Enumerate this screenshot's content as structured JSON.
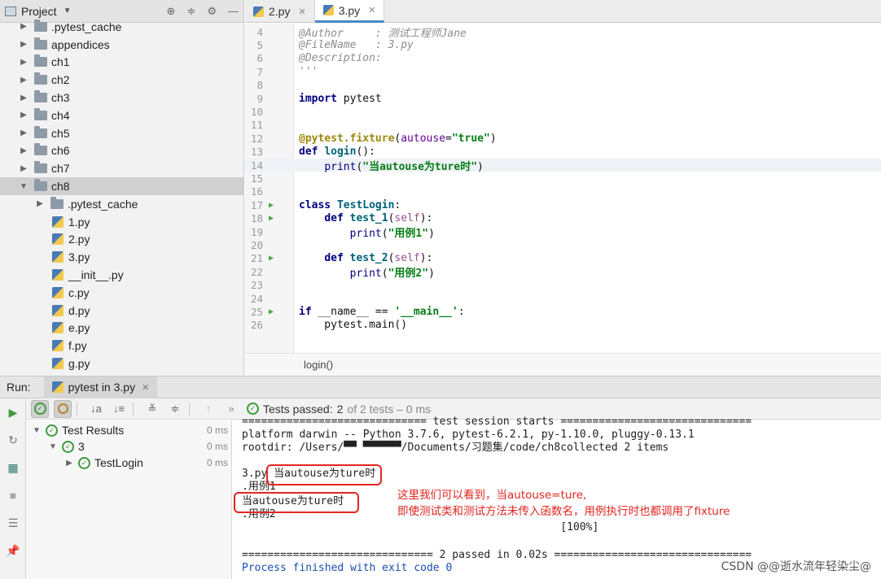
{
  "project": {
    "title": "Project",
    "tree": [
      {
        "label": ".pytest_cache",
        "kind": "folder",
        "depth": 0,
        "expanded": false
      },
      {
        "label": "appendices",
        "kind": "folder",
        "depth": 0,
        "expanded": false
      },
      {
        "label": "ch1",
        "kind": "folder",
        "depth": 0,
        "expanded": false
      },
      {
        "label": "ch2",
        "kind": "folder",
        "depth": 0,
        "expanded": false
      },
      {
        "label": "ch3",
        "kind": "folder",
        "depth": 0,
        "expanded": false
      },
      {
        "label": "ch4",
        "kind": "folder",
        "depth": 0,
        "expanded": false
      },
      {
        "label": "ch5",
        "kind": "folder",
        "depth": 0,
        "expanded": false
      },
      {
        "label": "ch6",
        "kind": "folder",
        "depth": 0,
        "expanded": false
      },
      {
        "label": "ch7",
        "kind": "folder",
        "depth": 0,
        "expanded": false
      },
      {
        "label": "ch8",
        "kind": "folder",
        "depth": 0,
        "expanded": true,
        "selected": true
      },
      {
        "label": ".pytest_cache",
        "kind": "folder",
        "depth": 1,
        "expanded": false
      },
      {
        "label": "1.py",
        "kind": "file",
        "depth": 1
      },
      {
        "label": "2.py",
        "kind": "file",
        "depth": 1
      },
      {
        "label": "3.py",
        "kind": "file",
        "depth": 1
      },
      {
        "label": "__init__.py",
        "kind": "file",
        "depth": 1
      },
      {
        "label": "c.py",
        "kind": "file",
        "depth": 1
      },
      {
        "label": "d.py",
        "kind": "file",
        "depth": 1
      },
      {
        "label": "e.py",
        "kind": "file",
        "depth": 1
      },
      {
        "label": "f.py",
        "kind": "file",
        "depth": 1
      },
      {
        "label": "g.py",
        "kind": "file",
        "depth": 1
      }
    ]
  },
  "editor": {
    "tabs": [
      {
        "label": "2.py",
        "active": false
      },
      {
        "label": "3.py",
        "active": true
      }
    ],
    "lines": [
      {
        "n": "4",
        "html": "<span class=\"cm\">@Author     : 测试工程师Jane</span>"
      },
      {
        "n": "5",
        "html": "<span class=\"cm\">@FileName   : 3.py</span>"
      },
      {
        "n": "6",
        "html": "<span class=\"cm\">@Description:</span>"
      },
      {
        "n": "7",
        "html": "<span class=\"cm\">'''</span>"
      },
      {
        "n": "8",
        "html": ""
      },
      {
        "n": "9",
        "html": "<span class=\"k\">import</span> pytest"
      },
      {
        "n": "10",
        "html": ""
      },
      {
        "n": "11",
        "html": ""
      },
      {
        "n": "12",
        "html": "<span class=\"dec\">@pytest.fixture</span>(<span class=\"kw\">autouse</span>=<span class=\"st\">\"true\"</span>)"
      },
      {
        "n": "13",
        "html": "<span class=\"k\">def</span> <span class=\"fn\">login</span>():"
      },
      {
        "n": "14",
        "html": "    <span class=\"bi\">print</span>(<span class=\"st\">\"当autouse为ture时\"</span>)",
        "current": true
      },
      {
        "n": "15",
        "html": ""
      },
      {
        "n": "16",
        "html": ""
      },
      {
        "n": "17",
        "html": "<span class=\"k\">class</span> <span class=\"fn\">TestLogin</span>:",
        "run": true
      },
      {
        "n": "18",
        "html": "    <span class=\"k\">def</span> <span class=\"fn\">test_1</span>(<span class=\"self\">self</span>):",
        "run": true
      },
      {
        "n": "19",
        "html": "        <span class=\"bi\">print</span>(<span class=\"st\">\"用例1\"</span>)"
      },
      {
        "n": "20",
        "html": ""
      },
      {
        "n": "21",
        "html": "    <span class=\"k\">def</span> <span class=\"fn\">test_2</span>(<span class=\"self\">self</span>):",
        "run": true
      },
      {
        "n": "22",
        "html": "        <span class=\"bi\">print</span>(<span class=\"st\">\"用例2\"</span>)"
      },
      {
        "n": "23",
        "html": ""
      },
      {
        "n": "24",
        "html": ""
      },
      {
        "n": "25",
        "html": "<span class=\"k\">if</span> __name__ == <span class=\"st\">'__main__'</span>:",
        "run": true
      },
      {
        "n": "26",
        "html": "    pytest.main()"
      }
    ],
    "breadcrumb": "login()"
  },
  "run": {
    "label": "Run:",
    "tab_label": "pytest in 3.py",
    "summary": {
      "prefix": "Tests passed:",
      "passed": "2",
      "rest": "of 2 tests – 0 ms"
    },
    "results": [
      {
        "name": "Test Results",
        "time": "0 ms",
        "depth": 0
      },
      {
        "name": "3",
        "time": "0 ms",
        "depth": 1
      },
      {
        "name": "TestLogin",
        "time": "0 ms",
        "depth": 2
      }
    ],
    "console": [
      "============================= test session starts ==============================",
      "platform darwin -- Python 3.7.6, pytest-6.2.1, py-1.10.0, pluggy-0.13.1",
      "rootdir: /Users/▀▀ ▀▀▀▀▀▀/Documents/习题集/code/ch8collected 2 items",
      "",
      "3.py 当autouse为ture时",
      ".用例1",
      "当autouse为ture时",
      ".用例2",
      "                                                  [100%]",
      "",
      "============================== 2 passed in 0.02s ===============================",
      "Process finished with exit code 0"
    ],
    "annotation_line1": "这里我们可以看到，当autouse=ture,",
    "annotation_line2": "即使测试类和测试方法未传入函数名，用例执行时也都调用了fixture"
  },
  "watermark": "CSDN @@逝水流年轻染尘@",
  "colors": {
    "pass_green": "#3d9a3d",
    "annotation_red": "#e0261f",
    "tab_accent": "#4a88c7"
  }
}
